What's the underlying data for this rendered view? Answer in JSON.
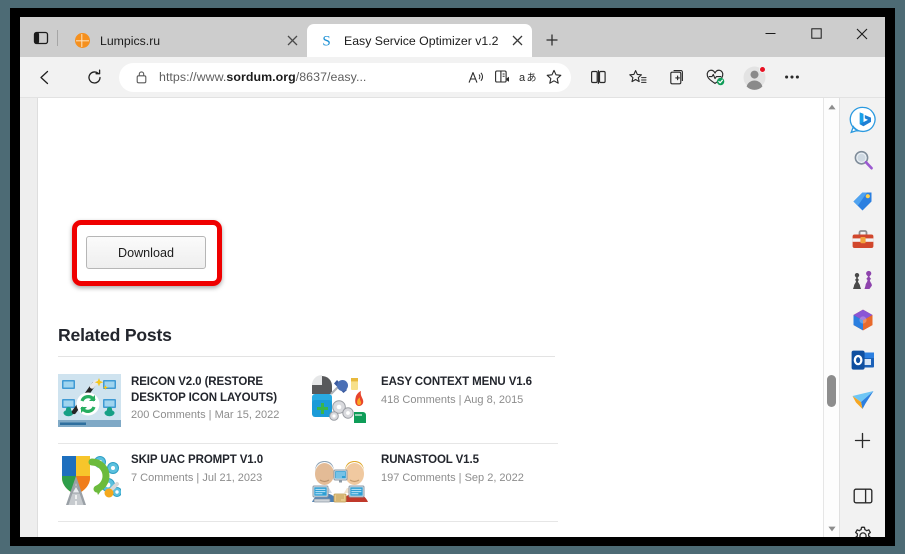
{
  "browser": {
    "tabs": [
      {
        "title": "Lumpics.ru",
        "favicon": "orange-slice-icon",
        "active": false
      },
      {
        "title": "Easy Service Optimizer v1.2",
        "favicon": "sordum-s-icon",
        "active": true
      }
    ],
    "new_tab_label": "+",
    "window_controls": {
      "minimize": "─",
      "maximize": "□",
      "close": "✕"
    },
    "nav": {
      "back": "back-arrow-icon",
      "refresh": "refresh-icon"
    },
    "address": {
      "lock": "lock-icon",
      "url_prefix": "https://www.",
      "url_domain": "sordum.org",
      "url_suffix": "/8637/easy...",
      "url_full": "https://www.sordum.org/8637/easy..."
    },
    "omnibox_icons": [
      "read-aloud-icon",
      "immersive-reader-icon",
      "translate-icon",
      "favorite-star-icon"
    ],
    "toolbar_icons": [
      "split-screen-icon",
      "favorites-icon",
      "collections-icon",
      "browser-essentials-icon",
      "profile-avatar-icon"
    ],
    "scrollbar": {
      "up": "▲",
      "down": "▼"
    }
  },
  "sidebar": {
    "items": [
      {
        "name": "copilot-bing-icon",
        "label": "Copilot"
      },
      {
        "name": "search-icon",
        "label": "Search"
      },
      {
        "name": "shopping-tag-icon",
        "label": "Shopping"
      },
      {
        "name": "tools-toolbox-icon",
        "label": "Tools"
      },
      {
        "name": "games-icon",
        "label": "Games"
      },
      {
        "name": "microsoft-365-icon",
        "label": "Microsoft 365"
      },
      {
        "name": "outlook-icon",
        "label": "Outlook"
      },
      {
        "name": "drop-send-icon",
        "label": "Drop"
      },
      {
        "name": "add-sidebar-app-icon",
        "label": "+"
      }
    ],
    "bottom_items": [
      {
        "name": "sidebar-panel-toggle-icon",
        "label": "Sidebar"
      },
      {
        "name": "sidebar-settings-gear-icon",
        "label": "Customize"
      }
    ]
  },
  "page": {
    "download_button": "Download",
    "related_heading": "Related Posts",
    "posts": [
      {
        "title": "REICON V2.0 (RESTORE DESKTOP ICON LAYOUTS)",
        "comments": "200 Comments",
        "date": "Mar 15, 2022",
        "separator": "|",
        "thumb": "reicon-desktop-wand-icon"
      },
      {
        "title": "EASY CONTEXT MENU V1.6",
        "comments": "418 Comments",
        "date": "Aug 8, 2015",
        "separator": "|",
        "thumb": "easy-context-menu-mouse-pin-icon"
      },
      {
        "title": "SKIP UAC PROMPT V1.0",
        "comments": "7 Comments",
        "date": "Jul 21, 2023",
        "separator": "|",
        "thumb": "skip-uac-shield-road-icon"
      },
      {
        "title": "RUNASTOOL V1.5",
        "comments": "197 Comments",
        "date": "Sep 2, 2022",
        "separator": "|",
        "thumb": "runastool-two-users-icon"
      }
    ]
  },
  "colors": {
    "highlight_red": "#ef0000",
    "tabstrip": "#cdcdcd",
    "toolbar": "#f2f2f2",
    "frame": "#000000",
    "backdrop": "#4d6b75"
  }
}
